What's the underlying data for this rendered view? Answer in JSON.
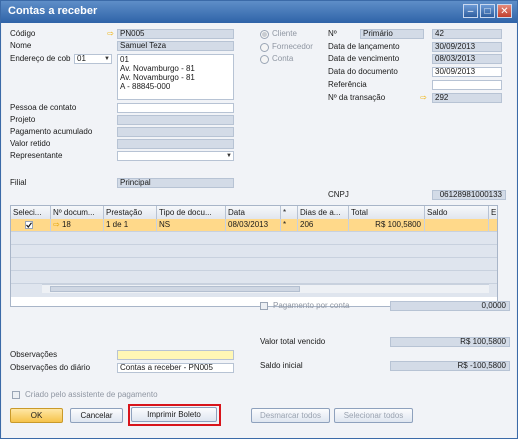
{
  "window": {
    "title": "Contas a receber"
  },
  "header_left": {
    "codigo_label": "Código",
    "codigo_value": "PN005",
    "nome_label": "Nome",
    "nome_value": "Samuel Teza",
    "endereco_label": "Endereço de cob",
    "endereco_select": "01",
    "address_lines": [
      "01",
      "Av. Novamburgo - 81",
      "Av. Novamburgo - 81",
      "A - 88845-000"
    ],
    "pessoa_label": "Pessoa de contato",
    "projeto_label": "Projeto",
    "pagamento_label": "Pagamento acumulado",
    "valor_retido_label": "Valor retido",
    "representante_label": "Representante",
    "filial_label": "Filial",
    "filial_value": "Principal"
  },
  "radio": {
    "cliente": "Cliente",
    "fornecedor": "Fornecedor",
    "conta": "Conta"
  },
  "header_right": {
    "numero_label": "Nº",
    "numero_series": "Primário",
    "numero_value": "42",
    "lancamento_label": "Data de lançamento",
    "lancamento_value": "30/09/2013",
    "vencimento_label": "Data de vencimento",
    "vencimento_value": "08/03/2013",
    "documento_label": "Data do documento",
    "documento_value": "30/09/2013",
    "referencia_label": "Referência",
    "transacao_label": "Nº da transação",
    "transacao_value": "292",
    "cnpj_label": "CNPJ",
    "cnpj_value": "06128981000133"
  },
  "grid": {
    "columns": [
      "Seleci...",
      "Nº docum...",
      "Prestação",
      "Tipo de docu...",
      "Data",
      "*",
      "Dias de a...",
      "Total",
      "Saldo",
      "E"
    ],
    "row": {
      "doc": "18",
      "prestacao": "1 de 1",
      "tipo": "NS",
      "data": "08/03/2013",
      "star": "*",
      "dias": "206",
      "total": "R$ 100,5800"
    }
  },
  "pagamento_por_conta": {
    "label": "Pagamento por conta",
    "value": "0,0000"
  },
  "totals": {
    "vencido_label": "Valor total vencido",
    "vencido_value": "R$ 100,5800",
    "saldo_label": "Saldo inicial",
    "saldo_value": "R$ -100,5800"
  },
  "observacoes": {
    "label": "Observações",
    "diario_label": "Observações do diário",
    "diario_value": "Contas a receber - PN005"
  },
  "criado_label": "Criado pelo assistente de pagamento",
  "buttons": {
    "ok": "OK",
    "cancel": "Cancelar",
    "print": "Imprimir Boleto",
    "unmark": "Desmarcar todos",
    "select": "Selecionar todos"
  },
  "colors": {
    "title_bar": "#2f63a8",
    "highlight_row": "#ffd98a",
    "yellow_field": "#fff7b5",
    "annotation_box": "#d8141b"
  }
}
